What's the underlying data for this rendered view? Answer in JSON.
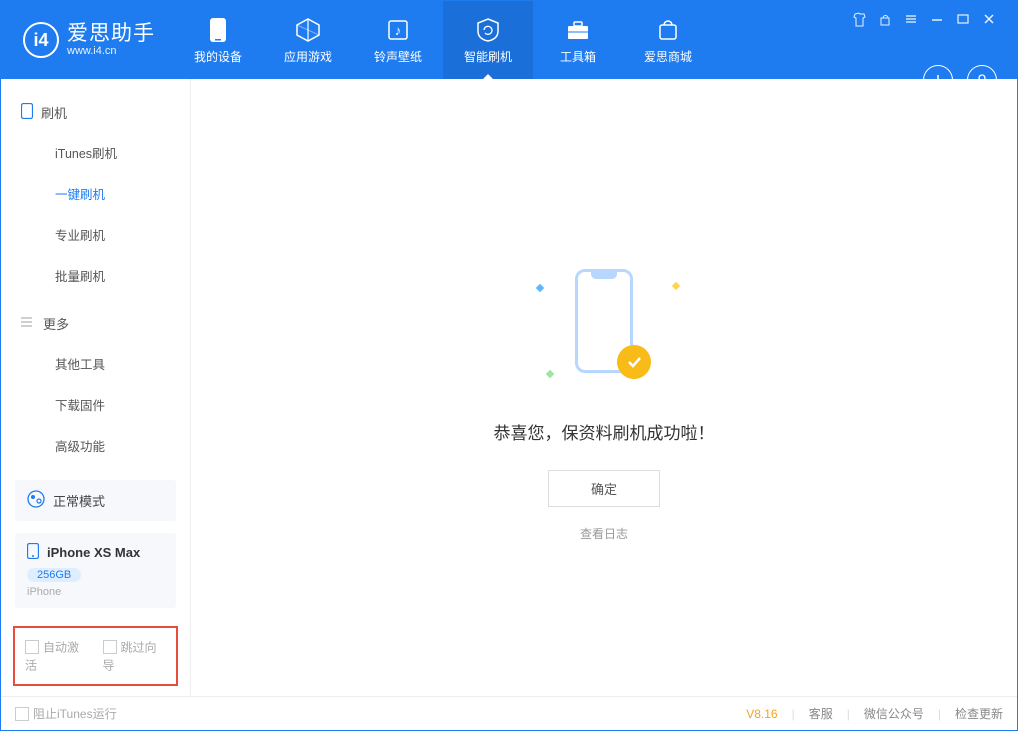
{
  "app": {
    "name_cn": "爱思助手",
    "name_en": "www.i4.cn"
  },
  "nav": [
    {
      "label": "我的设备"
    },
    {
      "label": "应用游戏"
    },
    {
      "label": "铃声壁纸"
    },
    {
      "label": "智能刷机"
    },
    {
      "label": "工具箱"
    },
    {
      "label": "爱思商城"
    }
  ],
  "sidebar": {
    "group1": {
      "title": "刷机",
      "items": [
        {
          "label": "iTunes刷机"
        },
        {
          "label": "一键刷机"
        },
        {
          "label": "专业刷机"
        },
        {
          "label": "批量刷机"
        }
      ]
    },
    "group2": {
      "title": "更多",
      "items": [
        {
          "label": "其他工具"
        },
        {
          "label": "下载固件"
        },
        {
          "label": "高级功能"
        }
      ]
    },
    "mode": "正常模式",
    "device": {
      "name": "iPhone XS Max",
      "capacity": "256GB",
      "type": "iPhone"
    },
    "options": {
      "auto_activate": "自动激活",
      "skip_guide": "跳过向导"
    }
  },
  "main": {
    "message": "恭喜您，保资料刷机成功啦！",
    "ok": "确定",
    "view_log": "查看日志"
  },
  "status": {
    "stop_itunes": "阻止iTunes运行",
    "version": "V8.16",
    "support": "客服",
    "wechat": "微信公众号",
    "check_update": "检查更新"
  }
}
